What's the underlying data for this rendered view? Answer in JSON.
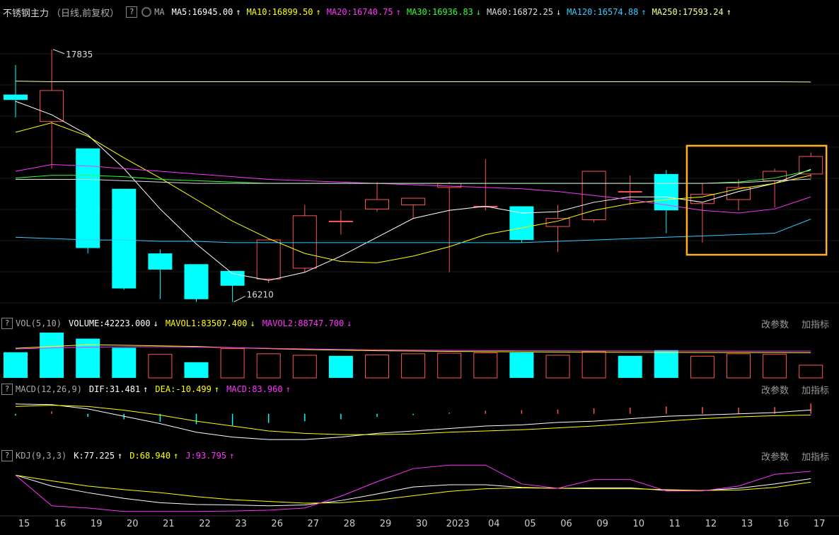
{
  "header": {
    "title": "不锈钢主力",
    "period": "（日线,前复权）",
    "help": "?",
    "ma_label": "MA",
    "ma": [
      {
        "label": "MA5:16945.00",
        "arrow": "↑",
        "color": "#ffffff"
      },
      {
        "label": "MA10:16899.50",
        "arrow": "↑",
        "color": "#ffff00"
      },
      {
        "label": "MA20:16740.75",
        "arrow": "↑",
        "color": "#ff33ff"
      },
      {
        "label": "MA30:16936.83",
        "arrow": "↓",
        "color": "#33ff33"
      },
      {
        "label": "MA60:16872.25",
        "arrow": "↓",
        "color": "#dddddd"
      },
      {
        "label": "MA120:16574.88",
        "arrow": "↑",
        "color": "#33ccff"
      },
      {
        "label": "MA250:17593.24",
        "arrow": "↑",
        "color": "#ffff99"
      }
    ]
  },
  "vol_header": {
    "help": "?",
    "name": "VOL(5,10)",
    "items": [
      {
        "label": "VOLUME:42223.000",
        "arrow": "↓",
        "color": "#ffffff"
      },
      {
        "label": "MAVOL1:83507.400",
        "arrow": "↓",
        "color": "#ffff00"
      },
      {
        "label": "MAVOL2:88747.700",
        "arrow": "↓",
        "color": "#ff33ff"
      }
    ],
    "btn1": "改参数",
    "btn2": "加指标"
  },
  "macd_header": {
    "help": "?",
    "name": "MACD(12,26,9)",
    "items": [
      {
        "label": "DIF:31.481",
        "arrow": "↑",
        "color": "#ffffff"
      },
      {
        "label": "DEA:-10.499",
        "arrow": "↑",
        "color": "#ffff00"
      },
      {
        "label": "MACD:83.960",
        "arrow": "↑",
        "color": "#ff33ff"
      }
    ],
    "btn1": "改参数",
    "btn2": "加指标"
  },
  "kdj_header": {
    "help": "?",
    "name": "KDJ(9,3,3)",
    "items": [
      {
        "label": "K:77.225",
        "arrow": "↑",
        "color": "#ffffff"
      },
      {
        "label": "D:68.940",
        "arrow": "↑",
        "color": "#ffff00"
      },
      {
        "label": "J:93.795",
        "arrow": "↑",
        "color": "#ff33ff"
      }
    ],
    "btn1": "改参数",
    "btn2": "加指标"
  },
  "chart_data": {
    "type": "candlestick",
    "categories": [
      "15",
      "16",
      "19",
      "20",
      "21",
      "22",
      "23",
      "26",
      "27",
      "28",
      "29",
      "30",
      "2023",
      "04",
      "05",
      "06",
      "09",
      "10",
      "11",
      "12",
      "13",
      "16",
      "17"
    ],
    "ohlc": [
      [
        17500,
        17720,
        17330,
        17460
      ],
      [
        17300,
        17835,
        16950,
        17530
      ],
      [
        17100,
        17100,
        16320,
        16360
      ],
      [
        16800,
        16800,
        16050,
        16060
      ],
      [
        16320,
        16350,
        15980,
        16200
      ],
      [
        16240,
        16240,
        15960,
        15980
      ],
      [
        16190,
        16190,
        15960,
        16080
      ],
      [
        16130,
        16430,
        16100,
        16420
      ],
      [
        16210,
        16680,
        16180,
        16600
      ],
      [
        16560,
        16640,
        16460,
        16560
      ],
      [
        16650,
        16850,
        16630,
        16720
      ],
      [
        16680,
        16720,
        16580,
        16730
      ],
      [
        16810,
        16850,
        16180,
        16840
      ],
      [
        16670,
        17020,
        16640,
        16670
      ],
      [
        16670,
        16670,
        16400,
        16420
      ],
      [
        16520,
        16680,
        16330,
        16580
      ],
      [
        16570,
        16920,
        16550,
        16930
      ],
      [
        16780,
        16900,
        16680,
        16780
      ],
      [
        16910,
        16940,
        16470,
        16640
      ],
      [
        16690,
        16840,
        16400,
        16760
      ],
      [
        16720,
        16870,
        16640,
        16810
      ],
      [
        16860,
        16950,
        16660,
        16930
      ],
      [
        16910,
        17070,
        16880,
        17040
      ]
    ],
    "ma_series": [
      {
        "color": "#ffffff",
        "values": [
          17450,
          17350,
          17200,
          16950,
          16650,
          16390,
          16170,
          16120,
          16180,
          16300,
          16440,
          16580,
          16640,
          16670,
          16620,
          16630,
          16700,
          16740,
          16740,
          16700,
          16780,
          16840,
          16945
        ]
      },
      {
        "color": "#ffff00",
        "values": [
          17220,
          17290,
          17190,
          17030,
          16880,
          16720,
          16560,
          16430,
          16320,
          16260,
          16250,
          16300,
          16370,
          16460,
          16510,
          16560,
          16640,
          16690,
          16720,
          16740,
          16800,
          16840,
          16900
        ]
      },
      {
        "color": "#ff33ff",
        "values": [
          16930,
          16980,
          16970,
          16950,
          16930,
          16910,
          16890,
          16870,
          16860,
          16850,
          16840,
          16830,
          16820,
          16810,
          16800,
          16780,
          16750,
          16720,
          16680,
          16640,
          16620,
          16650,
          16740
        ]
      },
      {
        "color": "#33ff33",
        "values": [
          16880,
          16900,
          16900,
          16890,
          16870,
          16860,
          16850,
          16840,
          16840,
          16840,
          16840,
          16840,
          16840,
          16840,
          16840,
          16840,
          16840,
          16840,
          16840,
          16840,
          16850,
          16880,
          16937
        ]
      },
      {
        "color": "#dddddd",
        "values": [
          16870,
          16870,
          16870,
          16860,
          16850,
          16840,
          16840,
          16840,
          16840,
          16840,
          16840,
          16840,
          16840,
          16840,
          16840,
          16840,
          16840,
          16840,
          16840,
          16840,
          16845,
          16860,
          16872
        ]
      },
      {
        "color": "#33ccff",
        "values": [
          16440,
          16430,
          16420,
          16420,
          16410,
          16410,
          16400,
          16400,
          16400,
          16400,
          16400,
          16400,
          16400,
          16400,
          16400,
          16410,
          16420,
          16430,
          16440,
          16450,
          16460,
          16470,
          16575
        ]
      },
      {
        "color": "#ffff99",
        "values": [
          17600,
          17595,
          17595,
          17595,
          17595,
          17595,
          17595,
          17595,
          17595,
          17595,
          17595,
          17595,
          17595,
          17595,
          17595,
          17595,
          17595,
          17595,
          17595,
          17595,
          17595,
          17595,
          17593
        ]
      }
    ],
    "price_range": [
      15900,
      17950
    ],
    "high_label": "17835",
    "low_label": "16210",
    "volume": [
      85000,
      150000,
      130000,
      100000,
      78000,
      52000,
      97000,
      80000,
      75000,
      73000,
      76000,
      80000,
      82000,
      83000,
      84000,
      75000,
      88000,
      73000,
      92000,
      72000,
      80000,
      78000,
      42223
    ],
    "vol_up": [
      false,
      false,
      false,
      false,
      true,
      false,
      true,
      true,
      true,
      false,
      true,
      true,
      true,
      true,
      false,
      true,
      true,
      false,
      false,
      true,
      true,
      true,
      true
    ],
    "vol_range": [
      0,
      150000
    ],
    "mavol1": [
      98000,
      104000,
      110000,
      108000,
      106000,
      104000,
      100000,
      97000,
      94000,
      92000,
      90000,
      89000,
      88000,
      87000,
      86000,
      85500,
      85000,
      84800,
      84500,
      84200,
      84000,
      83800,
      83507
    ],
    "mavol2": [
      96000,
      99000,
      102000,
      103000,
      103000,
      102000,
      100000,
      98000,
      96000,
      94000,
      93000,
      92000,
      91000,
      90500,
      90000,
      89800,
      89500,
      89300,
      89100,
      89000,
      88900,
      88800,
      88748
    ],
    "dif": [
      80,
      75,
      40,
      -20,
      -80,
      -150,
      -190,
      -210,
      -210,
      -190,
      -160,
      -140,
      -120,
      -100,
      -90,
      -70,
      -60,
      -40,
      -20,
      -10,
      0,
      10,
      31
    ],
    "dea": [
      60,
      70,
      60,
      30,
      -10,
      -60,
      -100,
      -140,
      -160,
      -170,
      -170,
      -165,
      -150,
      -140,
      -130,
      -115,
      -100,
      -80,
      -60,
      -40,
      -25,
      -15,
      -10
    ],
    "macd": [
      -15,
      20,
      -25,
      -45,
      -65,
      -85,
      -95,
      -75,
      -60,
      -45,
      -25,
      -10,
      10,
      25,
      30,
      35,
      45,
      50,
      60,
      55,
      50,
      55,
      84
    ],
    "k": [
      85,
      60,
      45,
      32,
      22,
      18,
      17,
      15,
      17,
      27,
      42,
      58,
      63,
      63,
      57,
      55,
      56,
      56,
      50,
      50,
      55,
      65,
      77
    ],
    "d": [
      85,
      72,
      60,
      52,
      45,
      36,
      29,
      25,
      21,
      22,
      28,
      38,
      48,
      54,
      56,
      55,
      54,
      54,
      52,
      50,
      51,
      57,
      69
    ],
    "j": [
      85,
      15,
      10,
      2,
      2,
      2,
      3,
      5,
      10,
      37,
      70,
      100,
      108,
      108,
      65,
      55,
      75,
      75,
      49,
      49,
      60,
      87,
      94
    ],
    "kdj_range": [
      0,
      110
    ]
  }
}
